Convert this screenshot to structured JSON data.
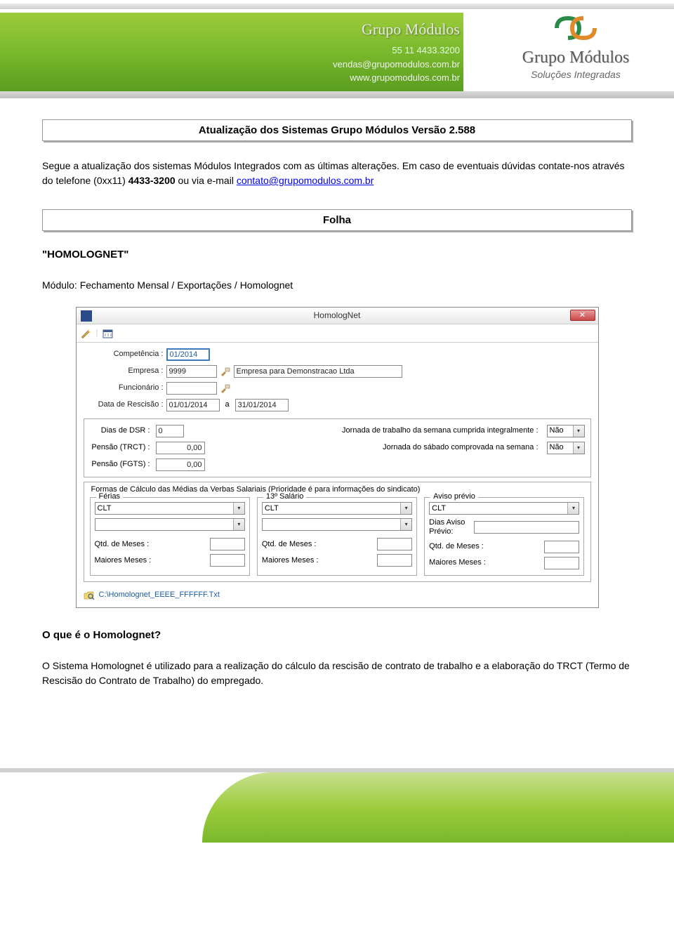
{
  "header": {
    "company_name": "Grupo Módulos",
    "phone": "55 11 4433.3200",
    "email": "vendas@grupomodulos.com.br",
    "website": "www.grupomodulos.com.br"
  },
  "logo": {
    "text": "Grupo Módulos",
    "subtitle": "Soluções Integradas"
  },
  "title": "Atualização dos Sistemas Grupo Módulos Versão 2.588",
  "intro": {
    "text_before": "Segue a atualização dos sistemas Módulos Integrados com as últimas alterações. Em caso de eventuais dúvidas contate-nos através do telefone (0xx11) ",
    "phone_bold": "4433-3200",
    "text_after": " ou via e-mail ",
    "email_link": "contato@grupomodulos.com.br"
  },
  "section_name": "Folha",
  "subsection_quoted": "\"HOMOLOGNET\"",
  "module_path": "Módulo: Fechamento Mensal / Exportações / Homolognet",
  "dialog": {
    "title": "HomologNet",
    "close_icon": "✕",
    "labels": {
      "competencia": "Competência :",
      "empresa": "Empresa :",
      "funcionario": "Funcionário :",
      "data_rescisao": "Data de Rescisão :",
      "date_sep": "a",
      "dias_dsr": "Dias de DSR :",
      "jornada_trabalho": "Jornada de trabalho da semana cumprida integralmente :",
      "pensao_trct": "Pensão (TRCT) :",
      "jornada_sabado": "Jornada do sábado comprovada na semana :",
      "pensao_fgts": "Pensão (FGTS) :",
      "calc_title": "Formas de Cálculo das Médias da Verbas Salariais  (Prioridade é para informações do sindicato)",
      "ferias": "Férias",
      "salario13": "13º Salário",
      "aviso_previo": "Aviso prévio",
      "dias_aviso": "Dias Aviso Prévio:",
      "qtd_meses": "Qtd. de Meses :",
      "maiores_meses": "Maiores Meses :"
    },
    "values": {
      "competencia": "01/2014",
      "empresa_code": "9999",
      "empresa_name": "Empresa para Demonstracao Ltda",
      "funcionario": "",
      "data_from": "01/01/2014",
      "data_to": "31/01/2014",
      "dias_dsr": "0",
      "pensao_trct": "0,00",
      "pensao_fgts": "0,00",
      "jornada_trabalho_sel": "Não",
      "jornada_sabado_sel": "Não",
      "clt": "CLT",
      "file_path": "C:\\Homolognet_EEEE_FFFFFF.Txt"
    }
  },
  "question": "O que é o Homolognet?",
  "answer": "O Sistema Homolognet é utilizado para a realização do cálculo da rescisão de contrato de trabalho e a elaboração do TRCT (Termo de Rescisão do Contrato de Trabalho) do empregado."
}
